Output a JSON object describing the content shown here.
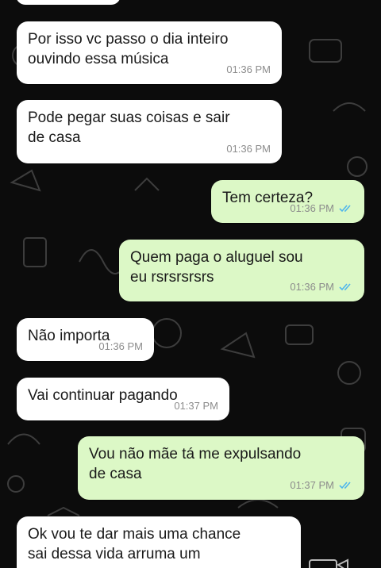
{
  "colors": {
    "background": "#0c0c0c",
    "incoming_bubble": "#ffffff",
    "outgoing_bubble": "#dcf8c6",
    "timestamp": "#8c8c8c",
    "read_ticks": "#4fb6ec"
  },
  "messages": [
    {
      "text": "Por isso vc passo o dia inteiro\nouvindo essa música",
      "time": "01:36 PM"
    },
    {
      "text": "Pode pegar suas coisas e sair\nde casa",
      "time": "01:36 PM"
    },
    {
      "text": "Tem certeza?",
      "time": "01:36 PM"
    },
    {
      "text": "Quem paga o aluguel sou\neu rsrsrsrsrs",
      "time": "01:36 PM"
    },
    {
      "text": "Não importa",
      "time": "01:36 PM"
    },
    {
      "text": "Vai continuar pagando",
      "time": "01:37 PM"
    },
    {
      "text": "Vou não mãe tá me expulsando\nde casa",
      "time": "01:37 PM"
    },
    {
      "text": "Ok vou te dar mais uma chance\nsai dessa vida arruma um"
    }
  ],
  "icons": {
    "read_receipt": "double-check-icon",
    "partial_bottom": "video-camera-icon"
  }
}
